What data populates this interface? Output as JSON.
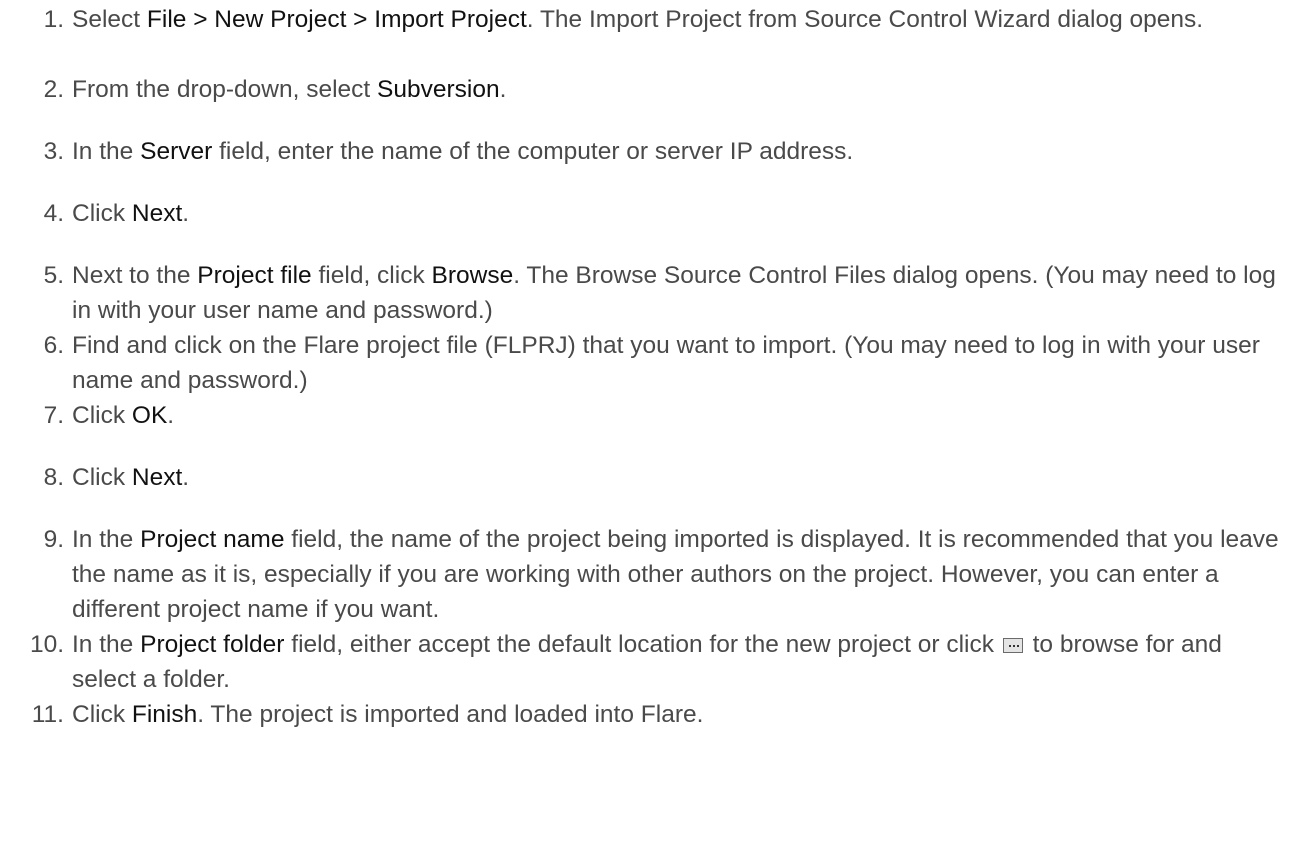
{
  "steps": [
    {
      "num": "1.",
      "parts": [
        {
          "t": "Select "
        },
        {
          "t": "File > New Project > Import Project",
          "b": true
        },
        {
          "t": ". The Import Project from Source Control Wizard dialog opens."
        }
      ]
    },
    {
      "num": "2.",
      "parts": [
        {
          "t": "From the drop-down, select "
        },
        {
          "t": "Subversion",
          "b": true
        },
        {
          "t": "."
        }
      ]
    },
    {
      "num": "3.",
      "parts": [
        {
          "t": "In the "
        },
        {
          "t": "Server",
          "b": true
        },
        {
          "t": " field, enter the name of the computer or server IP address."
        }
      ]
    },
    {
      "num": "4.",
      "parts": [
        {
          "t": "Click "
        },
        {
          "t": "Next",
          "b": true
        },
        {
          "t": "."
        }
      ]
    },
    {
      "num": "5.",
      "parts": [
        {
          "t": "Next to the "
        },
        {
          "t": "Project file",
          "b": true
        },
        {
          "t": " field, click "
        },
        {
          "t": "Browse",
          "b": true
        },
        {
          "t": ". The Browse Source Control Files dialog opens. (You may need to log in with your user name and password.)"
        }
      ]
    },
    {
      "num": "6.",
      "parts": [
        {
          "t": "Find and click on the Flare project file (FLPRJ) that you want to import. (You may need to log in with your user name and password.)"
        }
      ]
    },
    {
      "num": "7.",
      "parts": [
        {
          "t": "Click "
        },
        {
          "t": "OK",
          "b": true
        },
        {
          "t": "."
        }
      ]
    },
    {
      "num": "8.",
      "parts": [
        {
          "t": "Click "
        },
        {
          "t": "Next",
          "b": true
        },
        {
          "t": "."
        }
      ]
    },
    {
      "num": "9.",
      "parts": [
        {
          "t": "In the "
        },
        {
          "t": "Project name",
          "b": true
        },
        {
          "t": " field, the name of the project being imported is displayed. It is recommended that you leave the name as it is, especially if you are working with other authors on the project. However, you can enter a different project name if you want."
        }
      ]
    },
    {
      "num": "10.",
      "parts": [
        {
          "t": "In the "
        },
        {
          "t": "Project folder",
          "b": true
        },
        {
          "t": " field, either accept the default location for the new project or click "
        },
        {
          "icon": "browse-ellipsis-icon"
        },
        {
          "t": " to browse for and select a folder."
        }
      ]
    },
    {
      "num": "11.",
      "parts": [
        {
          "t": "Click "
        },
        {
          "t": "Finish",
          "b": true
        },
        {
          "t": ". The project is imported and loaded into Flare."
        }
      ]
    }
  ]
}
